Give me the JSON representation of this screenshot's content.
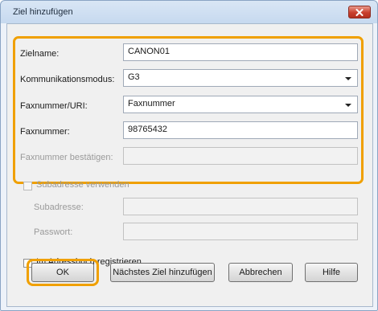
{
  "window": {
    "title": "Ziel hinzufügen"
  },
  "form": {
    "zielname": {
      "label": "Zielname:",
      "value": "CANON01"
    },
    "kommunikationsmodus": {
      "label": "Kommunikationsmodus:",
      "value": "G3"
    },
    "faxnummer_uri": {
      "label": "Faxnummer/URI:",
      "value": "Faxnummer"
    },
    "faxnummer": {
      "label": "Faxnummer:",
      "value": "98765432"
    },
    "faxnummer_bestaetigen": {
      "label": "Faxnummer bestätigen:",
      "value": ""
    }
  },
  "subaddress": {
    "checkbox_label": "Subadresse verwenden",
    "subadresse_label": "Subadresse:",
    "subadresse_value": "",
    "passwort_label": "Passwort:",
    "passwort_value": ""
  },
  "addressbook": {
    "checkbox_label": "Im Adressbuch registrieren"
  },
  "buttons": {
    "ok": "OK",
    "next": "Nächstes Ziel hinzufügen",
    "cancel": "Abbrechen",
    "help": "Hilfe"
  },
  "colors": {
    "highlight": "#f0a000",
    "close_button": "#c9402e"
  },
  "icons": {
    "close": "close-icon",
    "dropdown": "chevron-down-icon"
  }
}
